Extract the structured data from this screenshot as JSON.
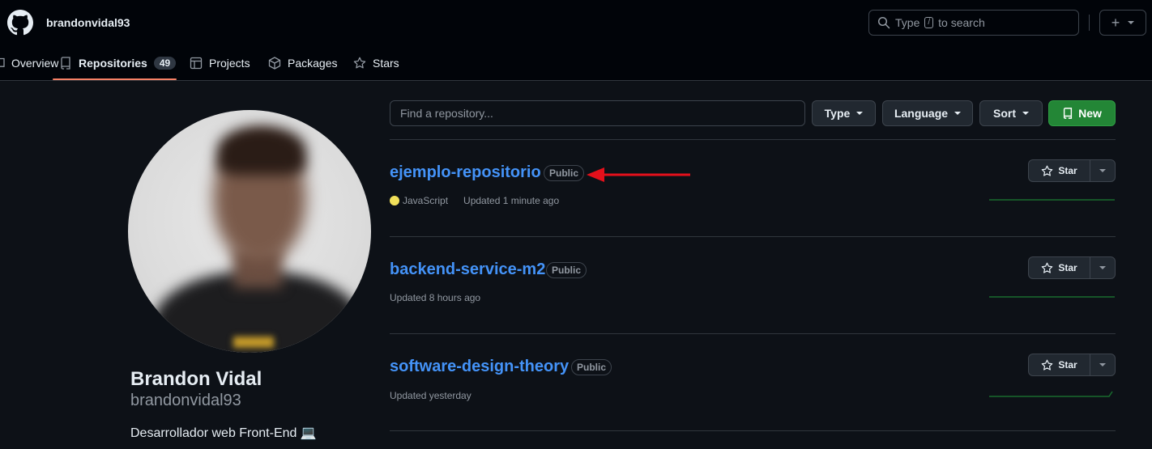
{
  "header": {
    "username": "brandonvidal93",
    "search_text_before": "Type",
    "search_key": "/",
    "search_text_after": "to search",
    "plus_label": "+"
  },
  "tabs": [
    {
      "label": "Overview",
      "icon": "book-icon"
    },
    {
      "label": "Repositories",
      "icon": "repo-icon",
      "count": "49",
      "active": true
    },
    {
      "label": "Projects",
      "icon": "table-icon"
    },
    {
      "label": "Packages",
      "icon": "package-icon"
    },
    {
      "label": "Stars",
      "icon": "star-icon"
    }
  ],
  "profile": {
    "full_name": "Brandon Vidal",
    "login": "brandonvidal93",
    "bio": "Desarrollador web Front-End 💻"
  },
  "filters": {
    "find_placeholder": "Find a repository...",
    "type_label": "Type",
    "language_label": "Language",
    "sort_label": "Sort",
    "new_label": "New"
  },
  "repositories": [
    {
      "name": "ejemplo-repositorio",
      "visibility": "Public",
      "language": "JavaScript",
      "language_color": "#f1e05a",
      "updated": "Updated 1 minute ago",
      "star_label": "Star"
    },
    {
      "name": "backend-service-m2",
      "visibility": "Public",
      "updated": "Updated 8 hours ago",
      "star_label": "Star"
    },
    {
      "name": "software-design-theory",
      "visibility": "Public",
      "updated": "Updated yesterday",
      "star_label": "Star"
    }
  ],
  "colors": {
    "link": "#4493f8",
    "accent_underline": "#f78166",
    "new_button": "#238636",
    "annotation_arrow": "#e5101b",
    "sparkline": "#196c2e"
  }
}
